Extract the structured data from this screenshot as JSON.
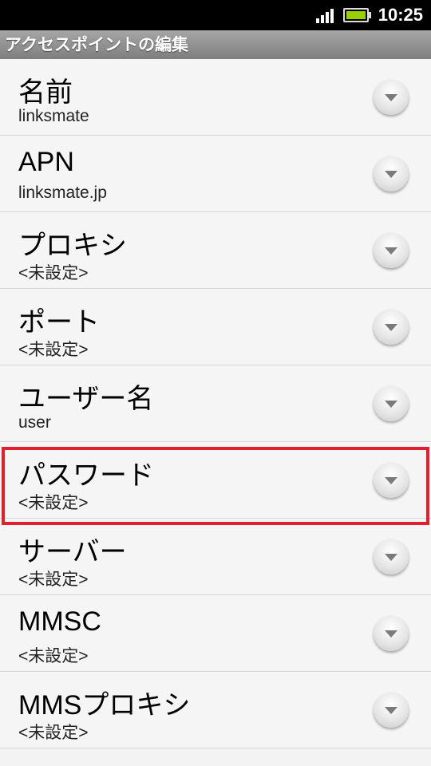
{
  "status_bar": {
    "time": "10:25"
  },
  "header": {
    "title": "アクセスポイントの編集"
  },
  "items": [
    {
      "label": "名前",
      "value": "linksmate"
    },
    {
      "label": "APN",
      "value": "linksmate.jp"
    },
    {
      "label": "プロキシ",
      "value": "<未設定>"
    },
    {
      "label": "ポート",
      "value": "<未設定>"
    },
    {
      "label": "ユーザー名",
      "value": "user"
    },
    {
      "label": "パスワード",
      "value": "<未設定>"
    },
    {
      "label": "サーバー",
      "value": "<未設定>"
    },
    {
      "label": "MMSC",
      "value": "<未設定>"
    },
    {
      "label": "MMSプロキシ",
      "value": "<未設定>"
    }
  ],
  "colors": {
    "highlight": "#e0202f",
    "battery": "#9bd000"
  }
}
